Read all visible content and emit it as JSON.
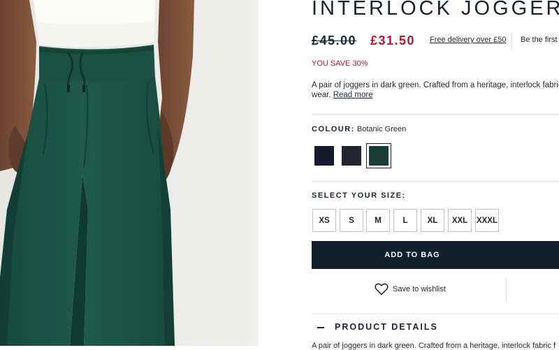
{
  "product": {
    "title": "INTERLOCK JOGGER",
    "price_was": "£45.00",
    "price_now": "£31.50",
    "delivery_link": "Free delivery over £50",
    "promo_text": "Be the first",
    "save_text": "YOU SAVE 30%",
    "description_line1": "A pair of joggers in dark green. Crafted from a heritage, interlock fabric f",
    "description_line2": "wear.",
    "read_more": "Read more",
    "colour_label": "COLOUR:",
    "colour_value": "Botanic Green",
    "swatches": [
      {
        "name": "Navy",
        "color": "#171a2c",
        "selected": false
      },
      {
        "name": "Charcoal",
        "color": "#24262f",
        "selected": false
      },
      {
        "name": "Botanic Green",
        "color": "#183d34",
        "selected": true
      }
    ],
    "size_label": "SELECT YOUR SIZE:",
    "sizes": [
      "XS",
      "S",
      "M",
      "L",
      "XL",
      "XXL",
      "XXXL"
    ],
    "add_to_bag": "ADD TO BAG",
    "wishlist": "Save to wishlist",
    "details_heading": "PRODUCT DETAILS",
    "details_cut": "A pair of joggers in dark green. Crafted from a heritage, interlock fabric f"
  },
  "colors": {
    "brand_navy": "#10202e",
    "sale_red": "#c8102e",
    "pants_green": "#1d5446"
  }
}
